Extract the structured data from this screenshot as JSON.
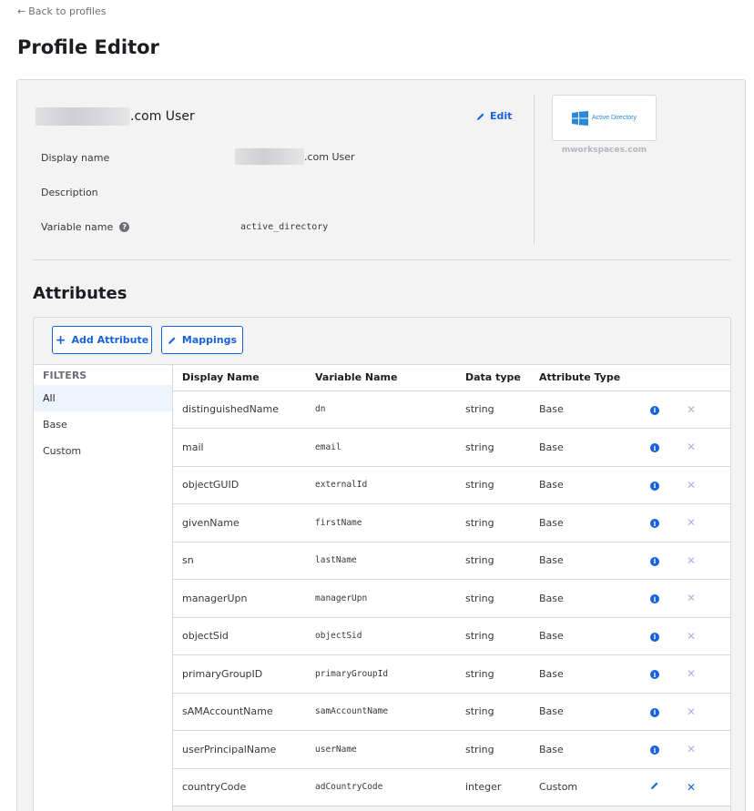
{
  "back_link": "Back to profiles",
  "page_title": "Profile Editor",
  "profile": {
    "name_suffix": ".com User",
    "edit_label": "Edit",
    "fields": [
      {
        "label": "Display name",
        "value": ".com User"
      },
      {
        "label": "Description",
        "value": ""
      },
      {
        "label": "Variable name",
        "value": "active_directory"
      }
    ],
    "logo_text": "Active Directory",
    "logo_caption": "mworkspaces.com"
  },
  "attributes": {
    "title": "Attributes",
    "add_button": "Add Attribute",
    "mappings_button": "Mappings",
    "filters_title": "FILTERS",
    "filters": [
      "All",
      "Base",
      "Custom"
    ],
    "columns": [
      "Display Name",
      "Variable Name",
      "Data type",
      "Attribute Type"
    ],
    "rows": [
      {
        "display_name": "distinguishedName",
        "variable_name": "dn",
        "data_type": "string",
        "attribute_type": "Base"
      },
      {
        "display_name": "mail",
        "variable_name": "email",
        "data_type": "string",
        "attribute_type": "Base"
      },
      {
        "display_name": "objectGUID",
        "variable_name": "externalId",
        "data_type": "string",
        "attribute_type": "Base"
      },
      {
        "display_name": "givenName",
        "variable_name": "firstName",
        "data_type": "string",
        "attribute_type": "Base"
      },
      {
        "display_name": "sn",
        "variable_name": "lastName",
        "data_type": "string",
        "attribute_type": "Base"
      },
      {
        "display_name": "managerUpn",
        "variable_name": "managerUpn",
        "data_type": "string",
        "attribute_type": "Base"
      },
      {
        "display_name": "objectSid",
        "variable_name": "objectSid",
        "data_type": "string",
        "attribute_type": "Base"
      },
      {
        "display_name": "primaryGroupID",
        "variable_name": "primaryGroupId",
        "data_type": "string",
        "attribute_type": "Base"
      },
      {
        "display_name": "sAMAccountName",
        "variable_name": "samAccountName",
        "data_type": "string",
        "attribute_type": "Base"
      },
      {
        "display_name": "userPrincipalName",
        "variable_name": "userName",
        "data_type": "string",
        "attribute_type": "Base"
      },
      {
        "display_name": "countryCode",
        "variable_name": "adCountryCode",
        "data_type": "integer",
        "attribute_type": "Custom"
      }
    ]
  },
  "colors": {
    "accent": "#1662dd",
    "card_bg": "#f3f3f4",
    "border": "#d7d7dc"
  }
}
